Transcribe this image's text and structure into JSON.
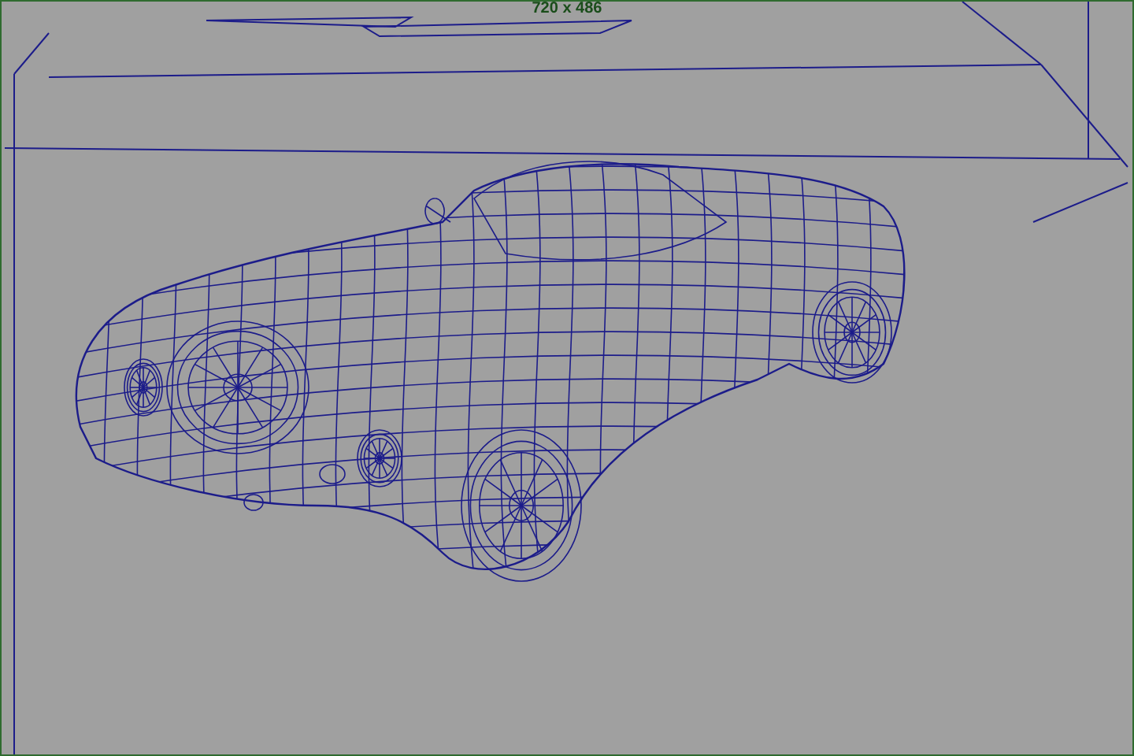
{
  "viewport": {
    "resolution_label": "720 x 486"
  }
}
